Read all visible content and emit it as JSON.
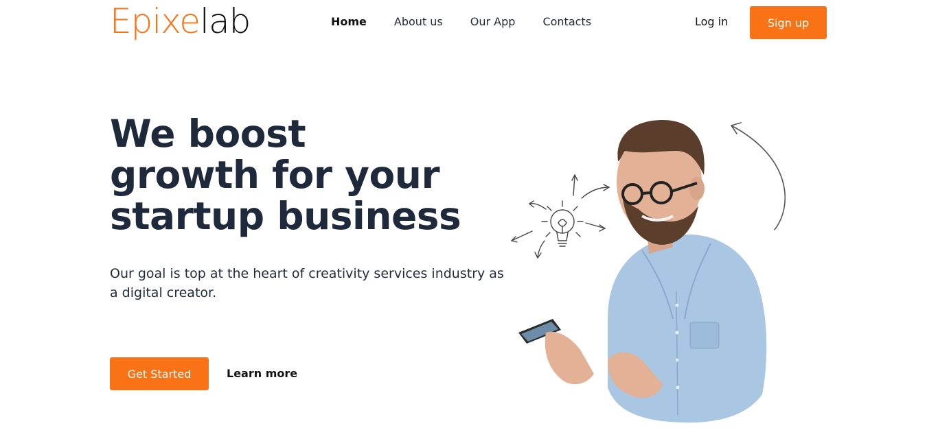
{
  "logo": {
    "part1": "Epixe",
    "part2": "lab"
  },
  "nav": {
    "items": [
      {
        "label": "Home",
        "active": true
      },
      {
        "label": "About us",
        "active": false
      },
      {
        "label": "Our App",
        "active": false
      },
      {
        "label": "Contacts",
        "active": false
      }
    ]
  },
  "auth": {
    "login_label": "Log in",
    "signup_label": "Sign up"
  },
  "hero": {
    "title_line1": "We boost",
    "title_line2": "growth for your",
    "title_line3": "startup business",
    "subtitle": "Our goal is top at the heart of creativity services industry as a digital creator.",
    "cta_label": "Get Started",
    "learn_more_label": "Learn more"
  },
  "colors": {
    "accent": "#f97316",
    "heading": "#1e293b",
    "shirt": "#a9c6e3"
  }
}
